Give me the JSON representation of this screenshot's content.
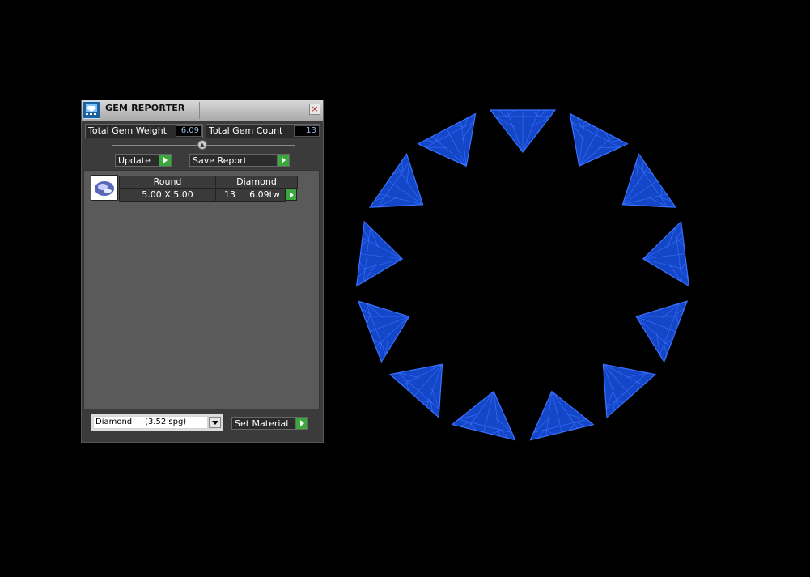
{
  "window": {
    "title": "GEM REPORTER",
    "close_label": "×"
  },
  "stats": {
    "weight_label": "Total Gem Weight",
    "weight_value": "6.09",
    "count_label": "Total Gem Count",
    "count_value": "13"
  },
  "buttons": {
    "update": "Update",
    "save_report": "Save Report",
    "set_material": "Set Material"
  },
  "gem_table": {
    "headers": [
      "Round",
      "Diamond"
    ],
    "rows": [
      {
        "size": "5.00 X 5.00",
        "count": "13",
        "weight": "6.09tw"
      }
    ]
  },
  "material_select": {
    "selected": "Diamond     (3.52 spg)"
  },
  "viewport": {
    "gem_count": 13,
    "gem_color": "#1446c8",
    "gem_edge_color": "#3a72ff"
  }
}
